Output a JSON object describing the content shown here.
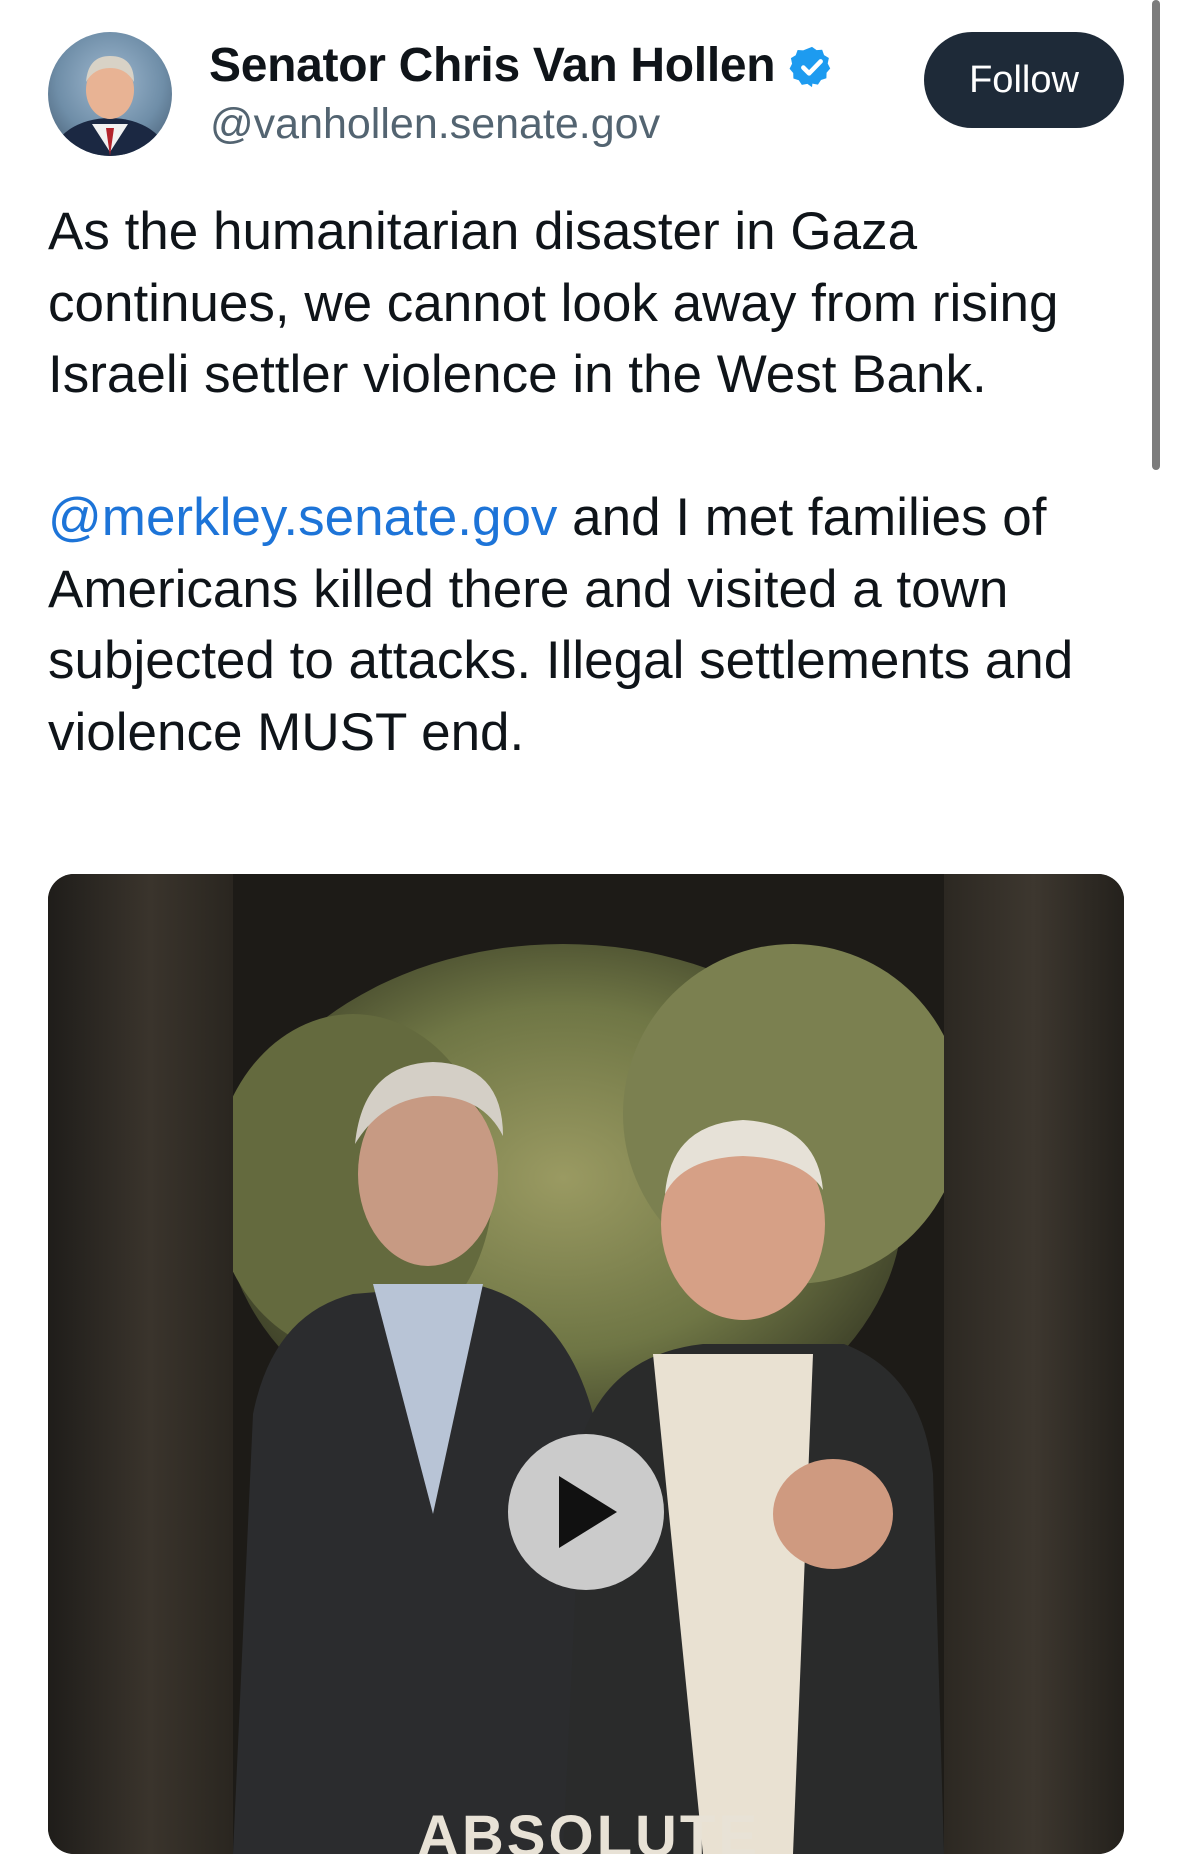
{
  "author": {
    "display_name": "Senator Chris Van Hollen",
    "handle": "@vanhollen.senate.gov",
    "verified_icon": "verified-check-icon",
    "avatar_icon": "profile-photo"
  },
  "follow_label": "Follow",
  "post": {
    "para1": "As the humanitarian disaster in Gaza continues, we cannot look away from rising Israeli settler violence in the West Bank.",
    "mention": "@merkley.senate.gov",
    "para2_rest": " and I met families of Americans killed there and visited a town subjected to attacks. Illegal settlements and violence MUST end."
  },
  "media": {
    "caption": "ABSOLUTE",
    "play_icon": "play-icon"
  },
  "colors": {
    "follow_bg": "#1e2a38",
    "mention": "#1d74d8",
    "verified": "#1d9bf0",
    "handle": "#536471"
  }
}
